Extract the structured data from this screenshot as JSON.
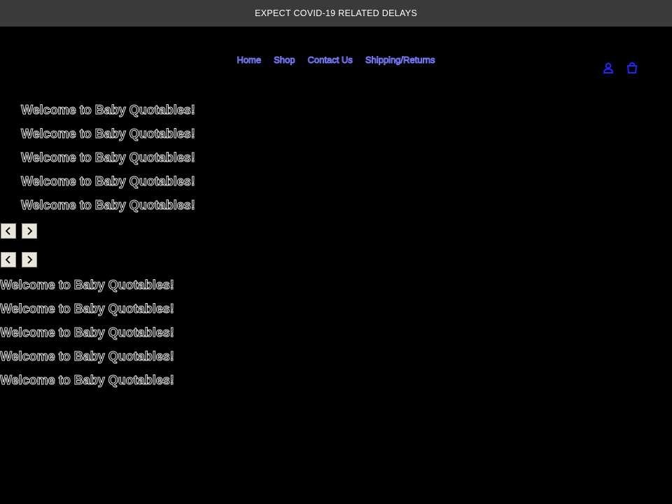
{
  "announcement": {
    "text": "EXPECT COVID-19 RELATED DELAYS"
  },
  "nav": {
    "items": [
      {
        "label": "Home"
      },
      {
        "label": "Shop"
      },
      {
        "label": "Contact Us"
      },
      {
        "label": "Shipping/Returns"
      }
    ]
  },
  "header_icons": {
    "account": "account-icon",
    "cart": "cart-icon",
    "color": "#2424ff"
  },
  "slideshow_top": {
    "slides": [
      "Welcome to Baby Quotables!",
      "Welcome to Baby Quotables!",
      "Welcome to Baby Quotables!",
      "Welcome to Baby Quotables!",
      "Welcome to Baby Quotables!"
    ]
  },
  "slideshow_bottom": {
    "slides": [
      "Welcome to Baby Quotables!",
      "Welcome to Baby Quotables!",
      "Welcome to Baby Quotables!",
      "Welcome to Baby Quotables!",
      "Welcome to Baby Quotables!"
    ]
  },
  "controls": {
    "prev_icon": "chevron-left-icon",
    "next_icon": "chevron-right-icon"
  }
}
